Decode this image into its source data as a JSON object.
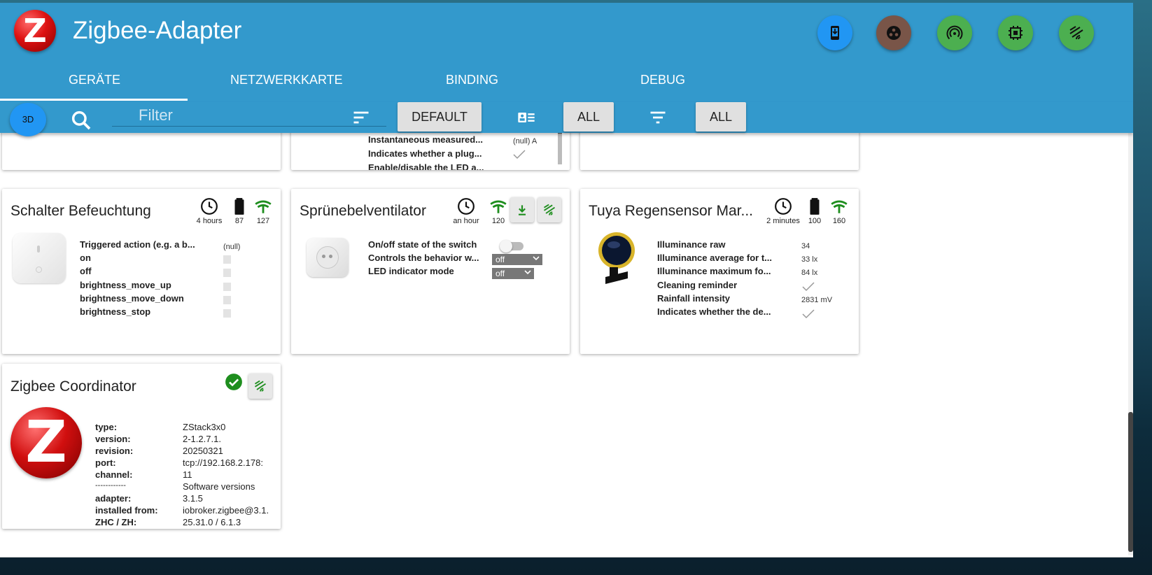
{
  "app": {
    "title": "Zigbee-Adapter",
    "logo_letter": "Z",
    "accent": "#3399cc"
  },
  "header_icons": [
    {
      "name": "phone-download-icon",
      "bg": "#2196f3"
    },
    {
      "name": "dots-circle-icon",
      "bg": "#795548"
    },
    {
      "name": "signal-podcast-icon",
      "bg": "#4caf50"
    },
    {
      "name": "chip-icon",
      "bg": "#4caf50"
    },
    {
      "name": "zigbee-waves-icon",
      "bg": "#4caf50"
    }
  ],
  "tabs": [
    "GERÄTE",
    "NETZWERKKARTE",
    "BINDING",
    "DEBUG"
  ],
  "toolbar": {
    "btn_3d": "3D",
    "filter_placeholder": "Filter",
    "sort_label": "DEFAULT",
    "view_label": "ALL",
    "filter_label": "ALL"
  },
  "top_partial_card": {
    "rows": [
      {
        "label": "Instantaneous measured...",
        "value": "(null) A"
      },
      {
        "label": "Indicates whether a plug..."
      },
      {
        "label": "Enable/disable the LED a..."
      }
    ]
  },
  "cards": [
    {
      "title": "Schalter Befeuchtung",
      "stats": {
        "time": "4 hours",
        "battery": "87",
        "link": "127"
      },
      "rows": [
        {
          "label": "Triggered action (e.g. a b...",
          "value": "(null)"
        },
        {
          "label": "on"
        },
        {
          "label": "off"
        },
        {
          "label": "brightness_move_up"
        },
        {
          "label": "brightness_move_down"
        },
        {
          "label": "brightness_stop"
        }
      ]
    },
    {
      "title": "Sprünebelventilator",
      "stats": {
        "time": "an hour",
        "link": "120"
      },
      "rows": [
        {
          "label": "On/off state of the switch"
        },
        {
          "label": "Controls the behavior w...",
          "value": "off"
        },
        {
          "label": "LED indicator mode",
          "value": "off"
        }
      ]
    },
    {
      "title": "Tuya Regensensor Mar...",
      "stats": {
        "time": "2 minutes",
        "battery": "100",
        "link": "160"
      },
      "rows": [
        {
          "label": "Illuminance raw",
          "value": "34"
        },
        {
          "label": "Illuminance average for t...",
          "value": "33 lx"
        },
        {
          "label": "Illuminance maximum fo...",
          "value": "84 lx"
        },
        {
          "label": "Cleaning reminder"
        },
        {
          "label": "Rainfall intensity",
          "value": "2831 mV"
        },
        {
          "label": "Indicates whether the de..."
        }
      ]
    }
  ],
  "coordinator": {
    "title": "Zigbee Coordinator",
    "rows": [
      {
        "k": "type:",
        "v": "ZStack3x0"
      },
      {
        "k": "version:",
        "v": "2-1.2.7.1."
      },
      {
        "k": "revision:",
        "v": "20250321"
      },
      {
        "k": "port:",
        "v": "tcp://192.168.2.178:"
      },
      {
        "k": "channel:",
        "v": "11"
      },
      {
        "k": "------------",
        "v": "Software versions"
      },
      {
        "k": "adapter:",
        "v": "3.1.5"
      },
      {
        "k": "installed from:",
        "v": "iobroker.zigbee@3.1."
      },
      {
        "k": "ZHC / ZH:",
        "v": "25.31.0 / 6.1.3"
      }
    ]
  }
}
